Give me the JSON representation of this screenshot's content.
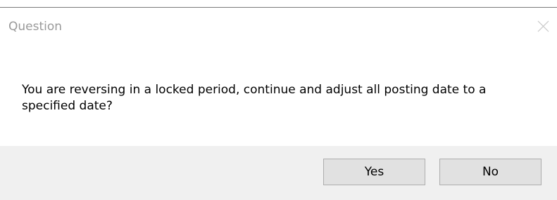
{
  "dialog": {
    "title": "Question",
    "message": "You are reversing in a locked period, continue and adjust all posting date to a specified date?",
    "buttons": {
      "yes_label": "Yes",
      "no_label": "No"
    },
    "close_icon": "close-icon"
  }
}
